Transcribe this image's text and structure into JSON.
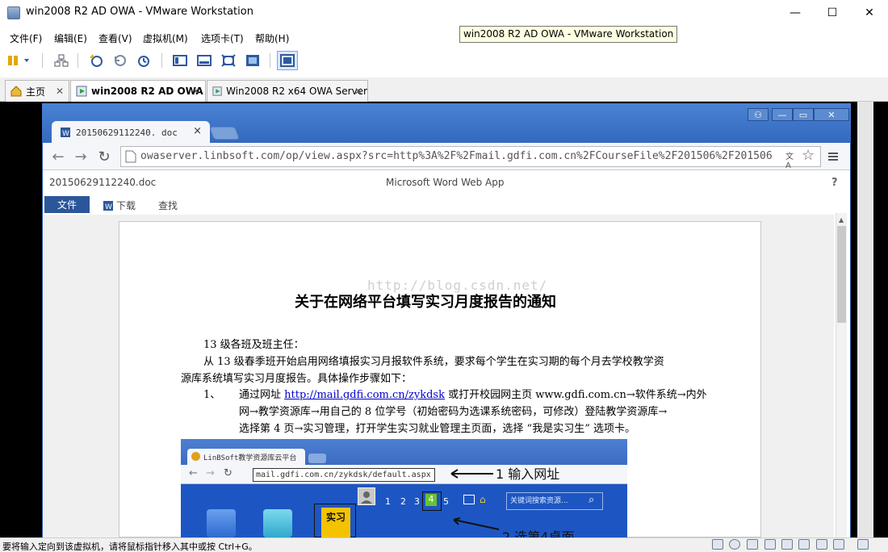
{
  "window": {
    "title": "win2008 R2 AD OWA - VMware Workstation",
    "minimize_glyph": "—",
    "maximize_glyph": "☐",
    "close_glyph": "✕"
  },
  "tooltip": {
    "text": "win2008 R2 AD OWA - VMware Workstation"
  },
  "menu": [
    "文件(F)",
    "编辑(E)",
    "查看(V)",
    "虚拟机(M)",
    "选项卡(T)",
    "帮助(H)"
  ],
  "tabs": [
    {
      "label": "主页",
      "active": false
    },
    {
      "label": "win2008 R2 AD OWA",
      "active": true
    },
    {
      "label": "Win2008 R2 x64 OWA Server",
      "active": false
    }
  ],
  "browser": {
    "tab_title": "20150629112240. doc",
    "url": "owaserver.linbsoft.com/op/view.aspx?src=http%3A%2F%2Fmail.gdfi.com.cn%2FCourseFile%2F201506%2F201506"
  },
  "office": {
    "doc_name": "20150629112240.doc",
    "app_name": "Microsoft Word Web App",
    "help": "?",
    "file_button": "文件",
    "download": "下载",
    "find": "查找"
  },
  "document": {
    "watermark": "http://blog.csdn.net/",
    "title": "关于在网络平台填写实习月度报告的通知",
    "greeting": "13 级各班及班主任：",
    "para1_line1": "从  13  级春季班开始启用网络填报实习月报软件系统，要求每个学生在实习期的每个月去学校教学资",
    "para1_line2": "源库系统填写实习月度报告。具体操作步骤如下：",
    "step_number": "1、",
    "step_pre": "通过网址",
    "step_link": "http://mail.gdfi.com.cn/zykdsk",
    "step_post": "或打开校园网主页 www.gdfi.com.cn→软件系统→内外",
    "step_line2": "网→教学资源库→用自己的 8 位学号（初始密码为选课系统密码，可修改）登陆教学资源库→",
    "step_line3": "选择第 4 页→实习管理，打开学生实习就业管理主页面，选择 “我是实习生” 选项卡。"
  },
  "screenshot": {
    "tab_title": "LinBSoft教学资源库云平台",
    "url": "mail.gdfi.com.cn/zykdsk/default.aspx",
    "annotation1": "1 输入网址",
    "annotation2": "2 选第4桌面",
    "pages": [
      "1",
      "2",
      "3",
      "4",
      "5"
    ],
    "search_placeholder": "关键词搜索资源...",
    "app_label": "实习"
  },
  "status": {
    "text": "要将输入定向到该虚拟机，请将鼠标指针移入其中或按 Ctrl+G。"
  }
}
